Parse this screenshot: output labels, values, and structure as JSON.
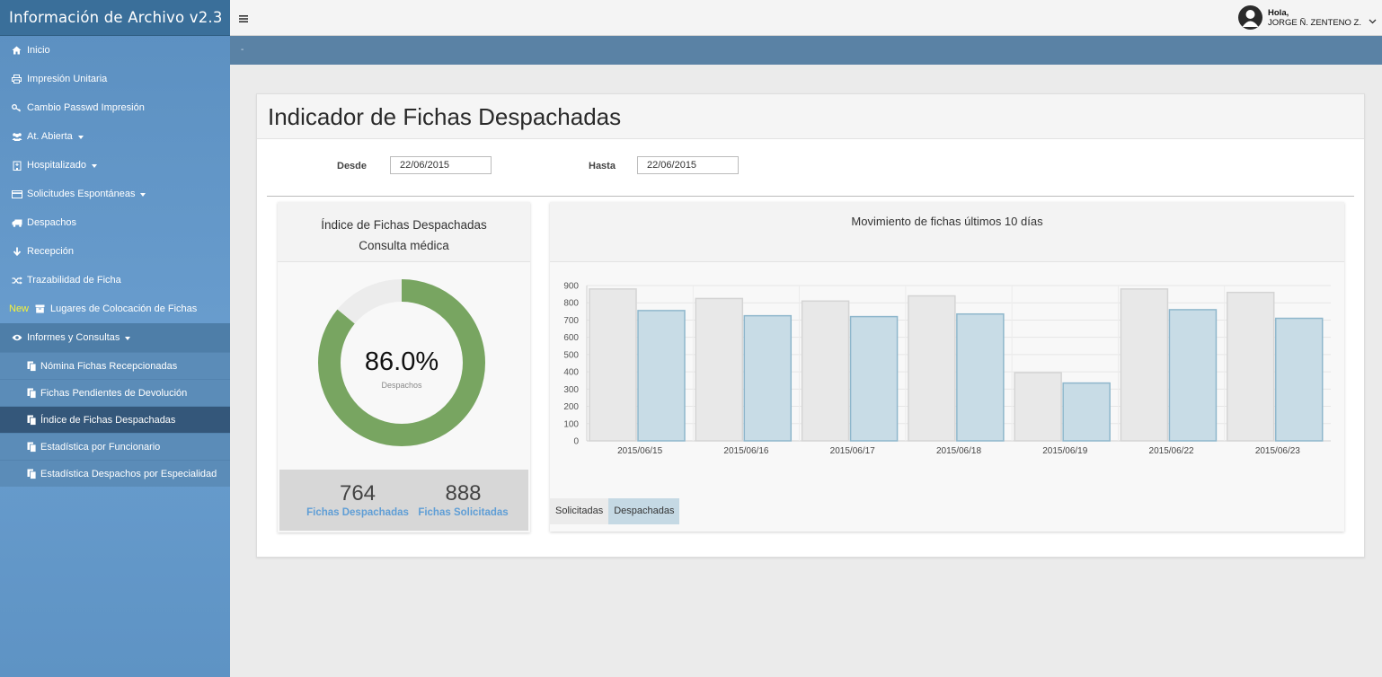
{
  "app": {
    "title": "Información de Archivo v2.3"
  },
  "user": {
    "greeting": "Hola,",
    "name": "JORGE Ñ. ZENTENO Z."
  },
  "subbar": {
    "text": "-"
  },
  "sidebar": {
    "items": [
      {
        "label": "Inicio",
        "icon": "home-icon"
      },
      {
        "label": "Impresión Unitaria",
        "icon": "print-icon"
      },
      {
        "label": "Cambio Passwd Impresión",
        "icon": "key-icon"
      },
      {
        "label": "At. Abierta",
        "icon": "users-icon"
      },
      {
        "label": "Hospitalizado",
        "icon": "hospital-icon"
      },
      {
        "label": "Solicitudes Espontáneas",
        "icon": "card-icon"
      },
      {
        "label": "Despachos",
        "icon": "truck-icon"
      },
      {
        "label": "Recepción",
        "icon": "arrow-down-icon"
      },
      {
        "label": "Trazabilidad de Ficha",
        "icon": "shuffle-icon"
      },
      {
        "label": "Lugares de Colocación de Fichas",
        "icon": "box-icon",
        "tag": "New"
      },
      {
        "label": "Informes y Consultas",
        "icon": "eye-icon"
      }
    ],
    "subitems": [
      {
        "label": "Nómina Fichas Recepcionadas"
      },
      {
        "label": "Fichas Pendientes de Devolución"
      },
      {
        "label": "Índice de Fichas Despachadas"
      },
      {
        "label": "Estadística por Funcionario"
      },
      {
        "label": "Estadística Despachos por Especialidad"
      }
    ]
  },
  "page": {
    "title": "Indicador de Fichas Despachadas",
    "desde_label": "Desde",
    "desde_value": "22/06/2015",
    "hasta_label": "Hasta",
    "hasta_value": "22/06/2015"
  },
  "index_card": {
    "title1": "Índice de Fichas Despachadas",
    "title2": "Consulta médica",
    "percent_text": "86.0%",
    "percent_value": 86.0,
    "center_label": "Despachos",
    "despachadas_value": "764",
    "despachadas_label": "Fichas Despachadas",
    "solicitadas_value": "888",
    "solicitadas_label": "Fichas Solicitadas"
  },
  "chart_card": {
    "title": "Movimiento de fichas últimos 10 días"
  },
  "chart_data": {
    "type": "bar",
    "title": "Movimiento de fichas últimos 10 días",
    "categories": [
      "2015/06/15",
      "2015/06/16",
      "2015/06/17",
      "2015/06/18",
      "2015/06/19",
      "2015/06/22",
      "2015/06/23"
    ],
    "series": [
      {
        "name": "Solicitadas",
        "values": [
          880,
          825,
          810,
          840,
          395,
          880,
          860
        ],
        "color": "#e8e8e8",
        "stroke": "#d4d4d4"
      },
      {
        "name": "Despachadas",
        "values": [
          755,
          725,
          720,
          735,
          335,
          760,
          710
        ],
        "color": "#c8dce6",
        "stroke": "#8fb7cc"
      }
    ],
    "yticks": [
      "0",
      "100",
      "200",
      "300",
      "400",
      "500",
      "600",
      "700",
      "800",
      "900"
    ],
    "ylim": [
      0,
      900
    ],
    "grid": true,
    "legend": "bottom-left"
  },
  "colors": {
    "donut": "#78a561",
    "donut_track": "#ececec",
    "accent_link": "#5f9ed6"
  }
}
